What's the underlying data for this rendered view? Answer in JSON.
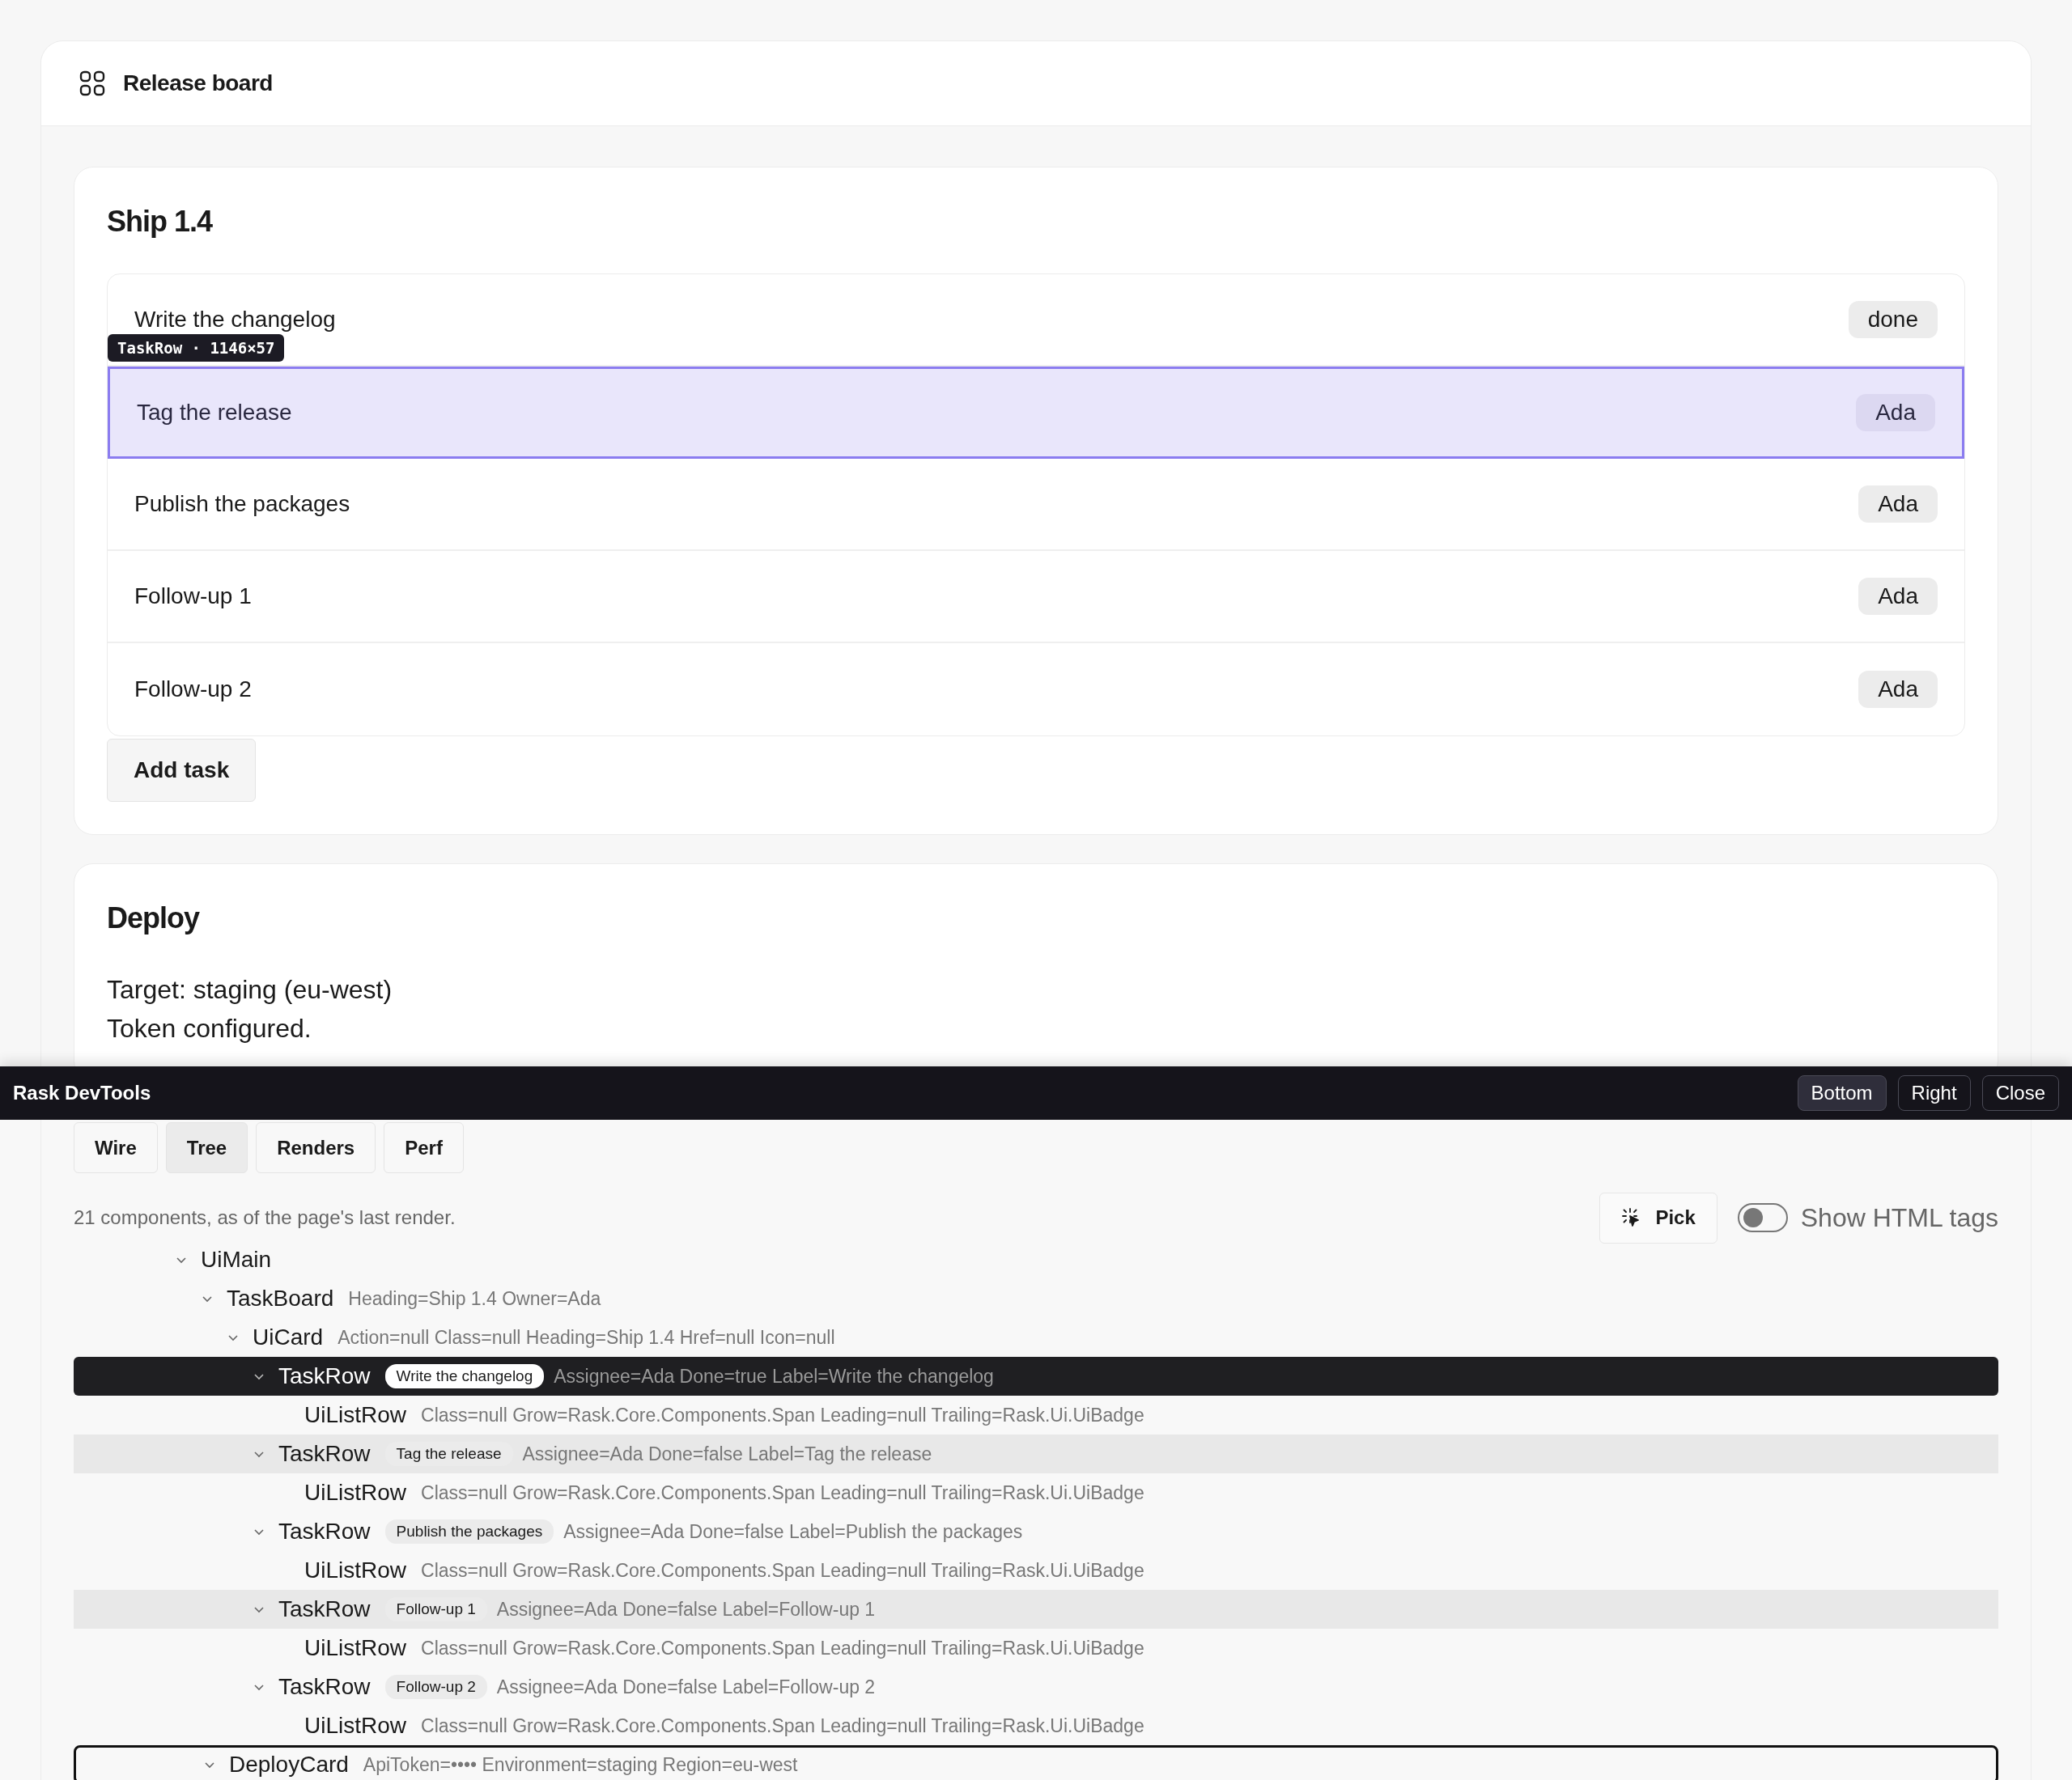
{
  "app": {
    "title": "Release board"
  },
  "board": {
    "heading": "Ship 1.4",
    "inspector_tooltip": "TaskRow · 1146×57",
    "add_button": "Add task",
    "tasks": [
      {
        "label": "Write the changelog",
        "badge": "done",
        "highlighted": false
      },
      {
        "label": "Tag the release",
        "badge": "Ada",
        "highlighted": true
      },
      {
        "label": "Publish the packages",
        "badge": "Ada",
        "highlighted": false
      },
      {
        "label": "Follow-up 1",
        "badge": "Ada",
        "highlighted": false
      },
      {
        "label": "Follow-up 2",
        "badge": "Ada",
        "highlighted": false
      }
    ]
  },
  "deploy": {
    "heading": "Deploy",
    "lines": [
      "Target: staging (eu-west)",
      "Token configured."
    ]
  },
  "devtools": {
    "title": "Rask DevTools",
    "close_button": "Close",
    "dock_buttons": [
      {
        "label": "Bottom",
        "selected": true
      },
      {
        "label": "Right",
        "selected": false
      }
    ],
    "tabs": [
      {
        "label": "Wire",
        "selected": false
      },
      {
        "label": "Tree",
        "selected": true
      },
      {
        "label": "Renders",
        "selected": false
      },
      {
        "label": "Perf",
        "selected": false
      }
    ],
    "status": "21 components, as of the page's last render.",
    "pick_button": "Pick",
    "show_html_tags": {
      "label": "Show HTML tags",
      "on": false
    },
    "tree": [
      {
        "name": "UiMain",
        "expanded": true,
        "selected": false,
        "outlined": false,
        "children": [
          {
            "name": "TaskBoard",
            "props": "Heading=Ship 1.4 Owner=Ada",
            "expanded": true,
            "selected": false,
            "outlined": false,
            "children": [
              {
                "name": "UiCard",
                "props": "Action=null Class=null Heading=Ship 1.4 Href=null Icon=null",
                "expanded": true,
                "selected": false,
                "outlined": false,
                "children": [
                  {
                    "name": "TaskRow",
                    "label": "Write the changelog",
                    "props": "Assignee=Ada Done=true Label=Write the changelog",
                    "expanded": true,
                    "selected": true,
                    "outlined": false,
                    "children": [
                      {
                        "name": "UiListRow",
                        "props": "Class=null Grow=Rask.Core.Components.Span Leading=null Trailing=Rask.Ui.UiBadge",
                        "selected": false,
                        "outlined": false
                      }
                    ]
                  },
                  {
                    "name": "TaskRow",
                    "label": "Tag the release",
                    "props": "Assignee=Ada Done=false Label=Tag the release",
                    "expanded": true,
                    "selected": false,
                    "outlined": false,
                    "children": [
                      {
                        "name": "UiListRow",
                        "props": "Class=null Grow=Rask.Core.Components.Span Leading=null Trailing=Rask.Ui.UiBadge",
                        "selected": false,
                        "outlined": false
                      }
                    ]
                  },
                  {
                    "name": "TaskRow",
                    "label": "Publish the packages",
                    "props": "Assignee=Ada Done=false Label=Publish the packages",
                    "expanded": true,
                    "selected": false,
                    "outlined": false,
                    "children": [
                      {
                        "name": "UiListRow",
                        "props": "Class=null Grow=Rask.Core.Components.Span Leading=null Trailing=Rask.Ui.UiBadge",
                        "selected": false,
                        "outlined": false
                      }
                    ]
                  },
                  {
                    "name": "TaskRow",
                    "label": "Follow-up 1",
                    "props": "Assignee=Ada Done=false Label=Follow-up 1",
                    "expanded": true,
                    "selected": false,
                    "outlined": false,
                    "children": [
                      {
                        "name": "UiListRow",
                        "props": "Class=null Grow=Rask.Core.Components.Span Leading=null Trailing=Rask.Ui.UiBadge",
                        "selected": false,
                        "outlined": false
                      }
                    ]
                  },
                  {
                    "name": "TaskRow",
                    "label": "Follow-up 2",
                    "props": "Assignee=Ada Done=false Label=Follow-up 2",
                    "expanded": true,
                    "selected": false,
                    "outlined": false,
                    "children": [
                      {
                        "name": "UiListRow",
                        "props": "Class=null Grow=Rask.Core.Components.Span Leading=null Trailing=Rask.Ui.UiBadge",
                        "selected": false,
                        "outlined": false
                      }
                    ]
                  }
                ]
              }
            ]
          },
          {
            "name": "DeployCard",
            "props": "ApiToken=•••• Environment=staging Region=eu-west",
            "expanded": true,
            "selected": false,
            "outlined": true
          }
        ]
      }
    ]
  }
}
